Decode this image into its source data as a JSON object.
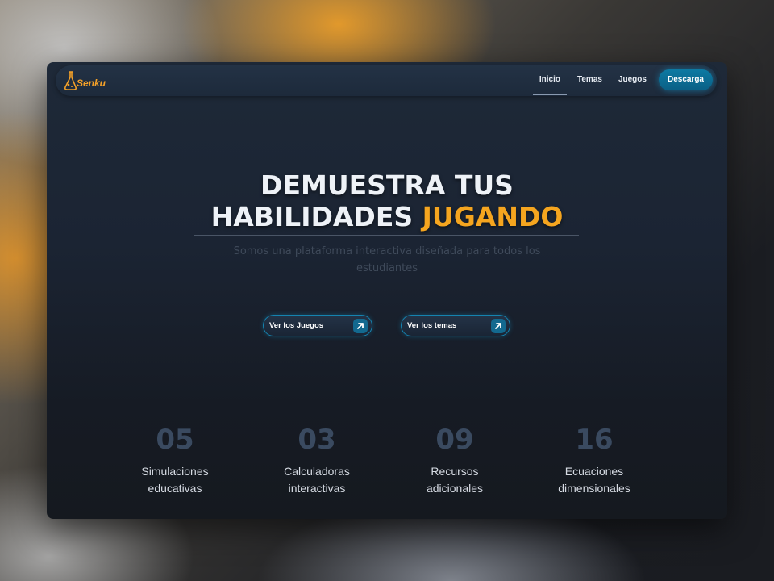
{
  "app": {
    "logo_text": "Senku",
    "logo_icon": "flask-icon"
  },
  "nav": {
    "links": [
      {
        "label": "Inicio",
        "active": true
      },
      {
        "label": "Temas",
        "active": false
      },
      {
        "label": "Juegos",
        "active": false
      }
    ],
    "download_label": "Descarga"
  },
  "hero": {
    "title_line1": "DEMUESTRA TUS",
    "title_line2_prefix": "HABILIDADES ",
    "title_line2_accent": "JUGANDO",
    "subtitle": "Somos una plataforma interactiva diseñada para todos los estudiantes"
  },
  "cta": {
    "games_label": "Ver los Juegos",
    "topics_label": "Ver los temas",
    "icon": "arrow-up-right-icon"
  },
  "stats": [
    {
      "number": "05",
      "label_line1": "Simulaciones",
      "label_line2": "educativas"
    },
    {
      "number": "03",
      "label_line1": "Calculadoras",
      "label_line2": "interactivas"
    },
    {
      "number": "09",
      "label_line1": "Recursos",
      "label_line2": "adicionales"
    },
    {
      "number": "16",
      "label_line1": "Ecuaciones",
      "label_line2": "dimensionales"
    }
  ],
  "colors": {
    "accent_orange": "#f5a51f",
    "accent_blue": "#0d7aa3",
    "panel_bg": "#1b2433",
    "stat_number": "#3a4a60"
  }
}
